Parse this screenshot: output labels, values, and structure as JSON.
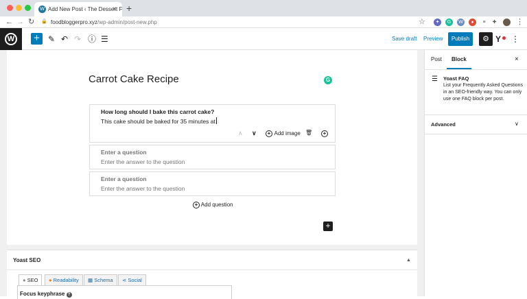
{
  "browser": {
    "tab_title": "Add New Post ‹ The Dessert F",
    "tab_favicon": "W",
    "close_glyph": "×",
    "newtab_glyph": "+",
    "url_domain": "foodbloggerpro.xyz",
    "url_path": "/wp-admin/post-new.php",
    "back_glyph": "←",
    "forward_glyph": "→",
    "reload_glyph": "↻",
    "lock_glyph": "🔒",
    "star_glyph": "☆",
    "traffic_colors": [
      "#ff5f57",
      "#febc2e",
      "#28c840"
    ],
    "extensions": [
      {
        "icon": "gear-ext-icon",
        "glyph": "✦",
        "color": "#5f6bc7"
      },
      {
        "icon": "grammarly-ext-icon",
        "glyph": "G",
        "color": "#15c39a"
      },
      {
        "icon": "wordpress-ext-icon",
        "glyph": "W",
        "color": "#6c8ebf"
      },
      {
        "icon": "red-ext-icon",
        "glyph": "●",
        "color": "#dd4b39"
      },
      {
        "icon": "list-ext-icon",
        "glyph": "≡",
        "color": "#555555"
      },
      {
        "icon": "puzzle-ext-icon",
        "glyph": "✚",
        "color": "#555555"
      },
      {
        "icon": "profile-avatar-icon",
        "glyph": "●",
        "color": "#6b5b4b"
      }
    ],
    "menu_glyph": "⋮"
  },
  "toolbar": {
    "add_block_glyph": "+",
    "tools_glyph": "✎",
    "undo_glyph": "↶",
    "redo_glyph": "↷",
    "details_glyph": "ⓘ",
    "outline_glyph": "☰",
    "save_draft": "Save draft",
    "preview": "Preview",
    "publish": "Publish",
    "settings_glyph": "⚙",
    "yoast_glyph": "Y",
    "more_glyph": "⋮"
  },
  "editor": {
    "post_title": "Carrot Cake Recipe",
    "grammarly_glyph": "G",
    "faq": [
      {
        "question": "How long should I bake this carrot cake?",
        "answer": "This cake should be baked for 35 minutes at"
      },
      {
        "question": "Enter a question",
        "answer": "Enter the answer to the question"
      },
      {
        "question": "Enter a question",
        "answer": "Enter the answer to the question"
      }
    ],
    "faq_controls": {
      "move_up_glyph": "∧",
      "move_down_glyph": "∨",
      "add_image": "Add image",
      "delete_glyph": "🗑",
      "insert_glyph": "+"
    },
    "add_question": "Add question",
    "inserter_glyph": "+"
  },
  "yoast": {
    "title": "Yoast SEO",
    "caret": "▲",
    "tabs": [
      {
        "label": "SEO",
        "icon": "seo-circle-icon",
        "color": "#888888"
      },
      {
        "label": "Readability",
        "icon": "readability-face-icon",
        "color": "#ee7c1b"
      },
      {
        "label": "Schema",
        "icon": "schema-grid-icon",
        "color": "#1e6aa6"
      },
      {
        "label": "Social",
        "icon": "share-icon",
        "color": "#1e6aa6"
      }
    ],
    "focus_keyphrase": "Focus keyphrase",
    "help_glyph": "?"
  },
  "sidebar": {
    "tab_post": "Post",
    "tab_block": "Block",
    "close_glyph": "×",
    "block_icon_glyph": "☰",
    "block_name": "Yoast FAQ",
    "block_desc": "List your Frequently Asked Questions in an SEO-friendly way. You can only use one FAQ block per post.",
    "advanced": "Advanced",
    "advanced_chevron": "∨"
  },
  "colors": {
    "wp_blue": "#007cba",
    "dark": "#1e1e1e"
  }
}
